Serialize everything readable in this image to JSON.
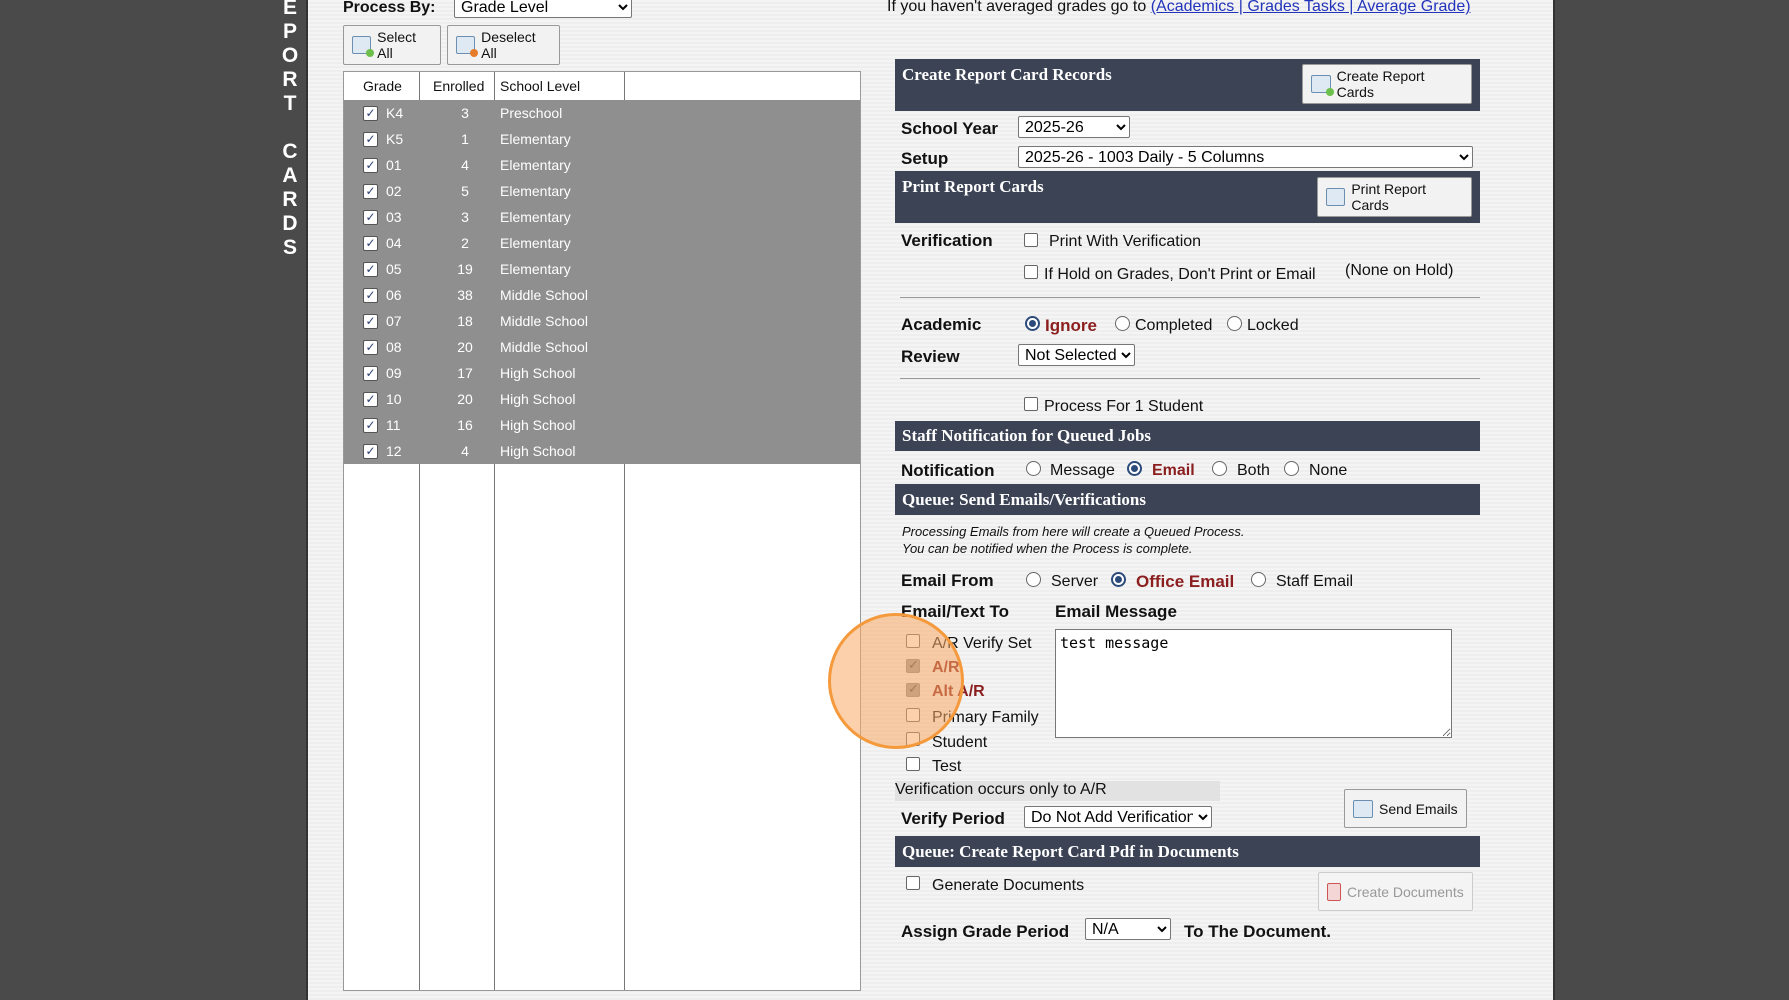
{
  "sidebar": {
    "title_letters": [
      "E",
      "P",
      "O",
      "R",
      "T",
      "",
      "C",
      "A",
      "R",
      "D",
      "S"
    ]
  },
  "header": {
    "process_by_label": "Process By:",
    "process_by_value": "Grade Level",
    "averaged_note": "If you haven't averaged grades go to",
    "averaged_link": "(Academics | Grades Tasks | Average Grade)",
    "select_all": "Select All",
    "deselect_all": "Deselect All"
  },
  "grades": {
    "columns": [
      "Grade",
      "Enrolled",
      "School Level"
    ],
    "rows": [
      {
        "grade": "K4",
        "enrolled": "3",
        "level": "Preschool"
      },
      {
        "grade": "K5",
        "enrolled": "1",
        "level": "Elementary"
      },
      {
        "grade": "01",
        "enrolled": "4",
        "level": "Elementary"
      },
      {
        "grade": "02",
        "enrolled": "5",
        "level": "Elementary"
      },
      {
        "grade": "03",
        "enrolled": "3",
        "level": "Elementary"
      },
      {
        "grade": "04",
        "enrolled": "2",
        "level": "Elementary"
      },
      {
        "grade": "05",
        "enrolled": "19",
        "level": "Elementary"
      },
      {
        "grade": "06",
        "enrolled": "38",
        "level": "Middle School"
      },
      {
        "grade": "07",
        "enrolled": "18",
        "level": "Middle School"
      },
      {
        "grade": "08",
        "enrolled": "20",
        "level": "Middle School"
      },
      {
        "grade": "09",
        "enrolled": "17",
        "level": "High School"
      },
      {
        "grade": "10",
        "enrolled": "20",
        "level": "High School"
      },
      {
        "grade": "11",
        "enrolled": "16",
        "level": "High School"
      },
      {
        "grade": "12",
        "enrolled": "4",
        "level": "High School"
      }
    ]
  },
  "create": {
    "section_title": "Create Report Card Records",
    "button": "Create Report Cards",
    "school_year_label": "School Year",
    "school_year_value": "2025-26",
    "setup_label": "Setup",
    "setup_value": "2025-26 - 1003 Daily - 5 Columns"
  },
  "print": {
    "section_title": "Print Report Cards",
    "button": "Print Report Cards",
    "verification_label": "Verification",
    "print_with_verification": "Print With Verification",
    "hold_option": "If Hold on Grades, Don't Print or Email",
    "hold_status": "(None on Hold)",
    "academic_label": "Academic",
    "review_label": "Review",
    "academic_options": [
      "Ignore",
      "Completed",
      "Locked"
    ],
    "review_value": "Not Selected",
    "process_one": "Process For 1 Student"
  },
  "staff": {
    "section_title": "Staff Notification for Queued Jobs",
    "notification_label": "Notification",
    "options": [
      "Message",
      "Email",
      "Both",
      "None"
    ]
  },
  "queue_email": {
    "section_title": "Queue: Send Emails/Verifications",
    "note_line1": "Processing Emails from here will create a Queued Process.",
    "note_line2": "You can be notified when the Process is complete.",
    "email_from_label": "Email From",
    "from_options": [
      "Server",
      "Office Email",
      "Staff Email"
    ],
    "email_to_label": "Email/Text To",
    "email_message_label": "Email Message",
    "recipients": [
      "A/R Verify Set",
      "A/R",
      "Alt A/R",
      "Primary Family",
      "Student",
      "Test"
    ],
    "message": "test message",
    "verification_note": "Verification occurs only to A/R",
    "verify_period_label": "Verify Period",
    "verify_period_value": "Do Not Add Verification",
    "send_button": "Send Emails"
  },
  "queue_pdf": {
    "section_title": "Queue: Create Report Card Pdf in Documents",
    "generate_label": "Generate Documents",
    "create_button": "Create Documents",
    "assign_label": "Assign Grade Period",
    "assign_value": "N/A",
    "to_document": "To The Document."
  }
}
